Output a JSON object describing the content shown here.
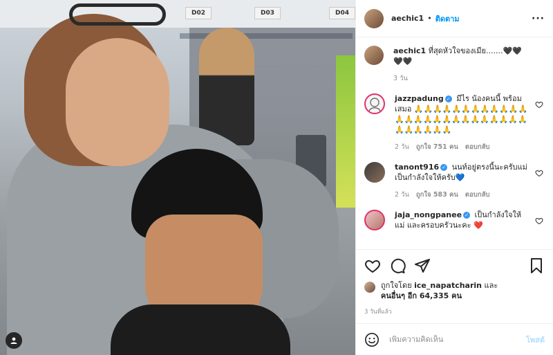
{
  "owner": {
    "username": "aechic1",
    "follow_label": "ติดตาม",
    "separator": "•",
    "more_label": "···"
  },
  "photo": {
    "signs": [
      "D02",
      "D03",
      "D04"
    ]
  },
  "caption": {
    "username": "aechic1",
    "text": "ที่สุดหัวใจของเมีย.......🖤🖤🖤🖤",
    "time": "3 วัน"
  },
  "comments": [
    {
      "username": "jazzpadung",
      "verified": true,
      "text": "มีไร น้องคนนี้ พร้อมเสมอ 🙏🙏🙏🙏🙏🙏🙏🙏🙏🙏🙏🙏🙏🙏🙏🙏🙏🙏🙏🙏🙏🙏🙏🙏🙏🙏🙏🙏🙏🙏🙏🙏",
      "time": "2 วัน",
      "likes": "ถูกใจ 751 คน",
      "reply": "ตอบกลับ"
    },
    {
      "username": "tanont916",
      "verified": true,
      "text": "นนท์อยู่ตรงนี้นะครับแม่ เป็นกำลังใจให้ครับ💙",
      "time": "2 วัน",
      "likes": "ถูกใจ 583 คน",
      "reply": "ตอบกลับ"
    },
    {
      "username": "jaja_nongpanee",
      "verified": true,
      "text": "เป็นกำลังใจให้แม่ และครอบครัวนะคะ ❤️"
    }
  ],
  "actions": {
    "liked_by_prefix": "ถูกใจโดย",
    "liked_by_user": "ice_napatcharin",
    "liked_by_and": "และ",
    "others_label": "คนอื่นๆ อีก 64,335 คน",
    "timestamp": "3 วันที่แล้ว"
  },
  "add_comment": {
    "placeholder": "เพิ่มความคิดเห็น",
    "post_label": "โพสต์"
  },
  "colors": {
    "link_blue": "#0095f6",
    "verified_blue": "#3897f0",
    "muted": "#8e8e8e",
    "post_disabled": "#b2dffc"
  },
  "icons": [
    "heart-icon",
    "comment-icon",
    "share-icon",
    "bookmark-icon",
    "emoji-icon",
    "verified-badge-icon",
    "user-tag-icon",
    "more-options-icon"
  ]
}
